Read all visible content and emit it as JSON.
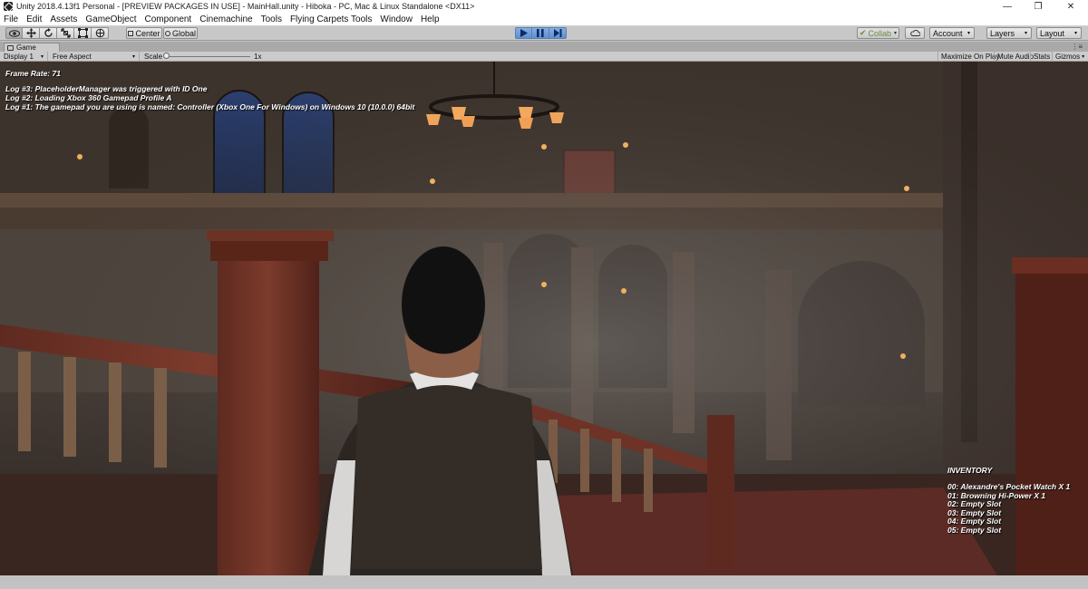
{
  "window": {
    "title": "Unity 2018.4.13f1 Personal - [PREVIEW PACKAGES IN USE] - MainHall.unity - Hiboka - PC, Mac & Linux Standalone <DX11>",
    "minimize": "—",
    "maximize": "❐",
    "close": "✕"
  },
  "menu": [
    "File",
    "Edit",
    "Assets",
    "GameObject",
    "Component",
    "Cinemachine",
    "Tools",
    "Flying Carpets Tools",
    "Window",
    "Help"
  ],
  "toolbar": {
    "tools": [
      "hand-tool",
      "move-tool",
      "rotate-tool",
      "scale-tool",
      "rect-tool",
      "transform-tool"
    ],
    "pivot": "Center",
    "space": "Global",
    "collab": "Collab",
    "account": "Account",
    "layers": "Layers",
    "layout": "Layout"
  },
  "game_tab": {
    "label": "Game",
    "display": "Display 1",
    "aspect": "Free Aspect",
    "scale_label": "Scale",
    "scale_value": "1x",
    "maximize_on_play": "Maximize On Play",
    "mute_audio": "Mute Audio",
    "stats": "Stats",
    "gizmos": "Gizmos"
  },
  "hud": {
    "frame_rate": "Frame Rate: 71",
    "logs": [
      "Log #3: PlaceholderManager was triggered with ID One",
      "Log #2: Loading Xbox 360 Gamepad Profile A",
      "Log #1: The gamepad you are using is named: Controller (Xbox One For Windows) on Windows 10  (10.0.0) 64bit"
    ],
    "inventory_title": "INVENTORY",
    "inventory": [
      "00: Alexandre's Pocket Watch X 1",
      "01: Browning Hi-Power X 1",
      "02: Empty Slot",
      "03: Empty Slot",
      "04: Empty Slot",
      "05: Empty Slot"
    ]
  }
}
